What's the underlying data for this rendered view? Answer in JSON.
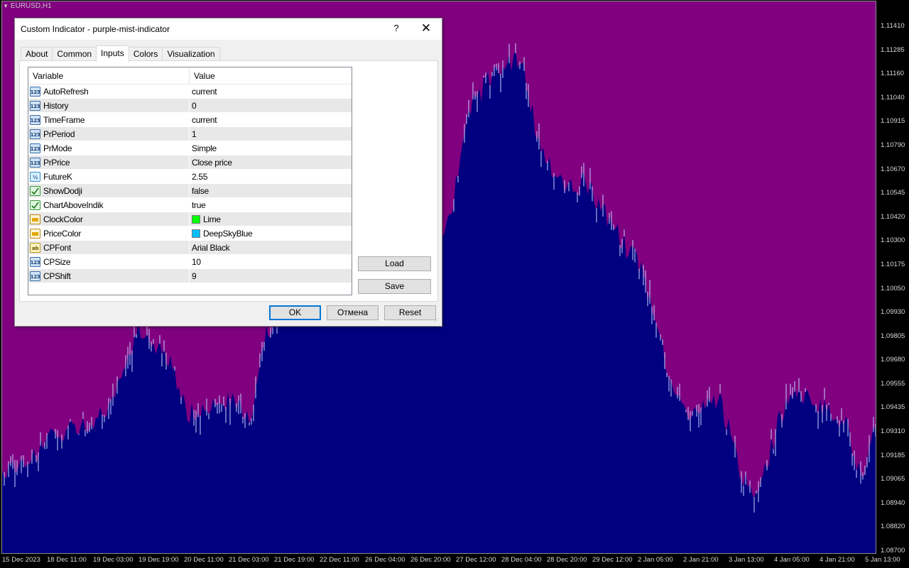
{
  "chart": {
    "symbol": "EURUSD,H1",
    "colors": {
      "background": "#000000",
      "upper": "#800080",
      "lower": "#000080",
      "candle": "#c8d4ff"
    },
    "y_ticks": [
      "1.11410",
      "1.11285",
      "1.11160",
      "1.11040",
      "1.10915",
      "1.10790",
      "1.10670",
      "1.10545",
      "1.10420",
      "1.10300",
      "1.10175",
      "1.10050",
      "1.09930",
      "1.09805",
      "1.09680",
      "1.09555",
      "1.09435",
      "1.09310",
      "1.09185",
      "1.09065",
      "1.08940",
      "1.08820",
      "1.08700"
    ],
    "x_ticks": [
      "15 Dec 2023",
      "18 Dec 11:00",
      "19 Dec 03:00",
      "19 Dec 19:00",
      "20 Dec 11:00",
      "21 Dec 03:00",
      "21 Dec 19:00",
      "22 Dec 11:00",
      "26 Dec 04:00",
      "26 Dec 20:00",
      "27 Dec 12:00",
      "28 Dec 04:00",
      "28 Dec 20:00",
      "29 Dec 12:00",
      "2 Jan 05:00",
      "2 Jan 21:00",
      "3 Jan 13:00",
      "4 Jan 05:00",
      "4 Jan 21:00",
      "5 Jan 13:00"
    ],
    "price_path": [
      [
        0,
        1.0912
      ],
      [
        40,
        1.0918
      ],
      [
        80,
        1.0932
      ],
      [
        120,
        1.0935
      ],
      [
        160,
        1.095
      ],
      [
        180,
        1.0972
      ],
      [
        190,
        1.0985
      ],
      [
        210,
        1.098
      ],
      [
        240,
        1.0965
      ],
      [
        260,
        1.094
      ],
      [
        300,
        1.0945
      ],
      [
        330,
        1.0948
      ],
      [
        350,
        1.094
      ],
      [
        370,
        1.0982
      ],
      [
        400,
        1.0995
      ],
      [
        430,
        1.102
      ],
      [
        470,
        1.101
      ],
      [
        520,
        1.1012
      ],
      [
        560,
        1.102
      ],
      [
        600,
        1.1025
      ],
      [
        630,
        1.1042
      ],
      [
        660,
        1.11
      ],
      [
        700,
        1.112
      ],
      [
        730,
        1.1125
      ],
      [
        760,
        1.1075
      ],
      [
        790,
        1.1058
      ],
      [
        820,
        1.106
      ],
      [
        860,
        1.1038
      ],
      [
        900,
        1.1015
      ],
      [
        930,
        1.0975
      ],
      [
        950,
        1.0945
      ],
      [
        980,
        1.094
      ],
      [
        1010,
        1.095
      ],
      [
        1040,
        1.091
      ],
      [
        1060,
        1.09
      ],
      [
        1080,
        1.092
      ],
      [
        1110,
        1.0955
      ],
      [
        1150,
        1.0945
      ],
      [
        1190,
        1.0935
      ],
      [
        1210,
        1.0905
      ],
      [
        1232,
        1.094
      ]
    ]
  },
  "dialog": {
    "title": "Custom Indicator - purple-mist-indicator",
    "help_glyph": "?",
    "close_glyph": "✕",
    "tabs": [
      {
        "label": "About",
        "active": false
      },
      {
        "label": "Common",
        "active": false
      },
      {
        "label": "Inputs",
        "active": true
      },
      {
        "label": "Colors",
        "active": false
      },
      {
        "label": "Visualization",
        "active": false
      }
    ],
    "grid": {
      "col_variable": "Variable",
      "col_value": "Value",
      "rows": [
        {
          "icon": "int-icon",
          "name": "AutoRefresh",
          "value": "current"
        },
        {
          "icon": "int-icon",
          "name": "History",
          "value": "0"
        },
        {
          "icon": "int-icon",
          "name": "TimeFrame",
          "value": "current"
        },
        {
          "icon": "int-icon",
          "name": "PrPeriod",
          "value": "1"
        },
        {
          "icon": "int-icon",
          "name": "PrMode",
          "value": "Simple"
        },
        {
          "icon": "int-icon",
          "name": "PrPrice",
          "value": "Close price"
        },
        {
          "icon": "double-icon",
          "name": "FutureK",
          "value": "2.55"
        },
        {
          "icon": "bool-icon",
          "name": "ShowDodji",
          "value": "false"
        },
        {
          "icon": "bool-icon",
          "name": "ChartAboveIndik",
          "value": "true"
        },
        {
          "icon": "color-icon",
          "name": "ClockColor",
          "value": "Lime",
          "swatch": "#00ff00"
        },
        {
          "icon": "color-icon",
          "name": "PriceColor",
          "value": "DeepSkyBlue",
          "swatch": "#00bfff"
        },
        {
          "icon": "string-icon",
          "name": "CPFont",
          "value": "Arial Black"
        },
        {
          "icon": "int-icon",
          "name": "CPSize",
          "value": "10"
        },
        {
          "icon": "int-icon",
          "name": "CPShift",
          "value": "9"
        }
      ]
    },
    "buttons": {
      "load": "Load",
      "save": "Save",
      "ok": "OK",
      "cancel": "Отмена",
      "reset": "Reset"
    }
  }
}
